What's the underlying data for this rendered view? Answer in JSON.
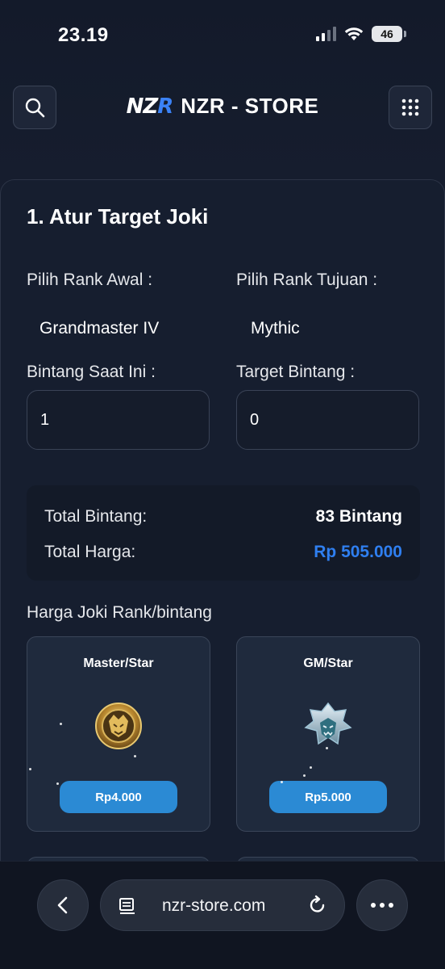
{
  "status_bar": {
    "time": "23.19",
    "battery": "46"
  },
  "header": {
    "brand_name": "NZR - STORE",
    "logo_left": "NZ",
    "logo_right": "R"
  },
  "form": {
    "section_title": "1. Atur Target Joki",
    "rank_start_label": "Pilih Rank Awal :",
    "rank_start_value": "Grandmaster IV",
    "rank_target_label": "Pilih Rank Tujuan :",
    "rank_target_value": "Mythic",
    "current_stars_label": "Bintang Saat Ini :",
    "current_stars_value": "1",
    "target_stars_label": "Target Bintang :",
    "target_stars_value": "0"
  },
  "summary": {
    "total_stars_label": "Total Bintang:",
    "total_stars_value": "83 Bintang",
    "total_price_label": "Total Harga:",
    "total_price_value": "Rp 505.000",
    "price_color": "#2f7ff0"
  },
  "pricing": {
    "title": "Harga Joki Rank/bintang",
    "cards": [
      {
        "name": "Master/Star",
        "price": "Rp4.000",
        "icon": "master-emblem-icon"
      },
      {
        "name": "GM/Star",
        "price": "Rp5.000",
        "icon": "grandmaster-emblem-icon"
      }
    ]
  },
  "browser": {
    "url": "nzr-store.com"
  },
  "colors": {
    "accent": "#2b8ad4",
    "background": "#151c2c"
  }
}
